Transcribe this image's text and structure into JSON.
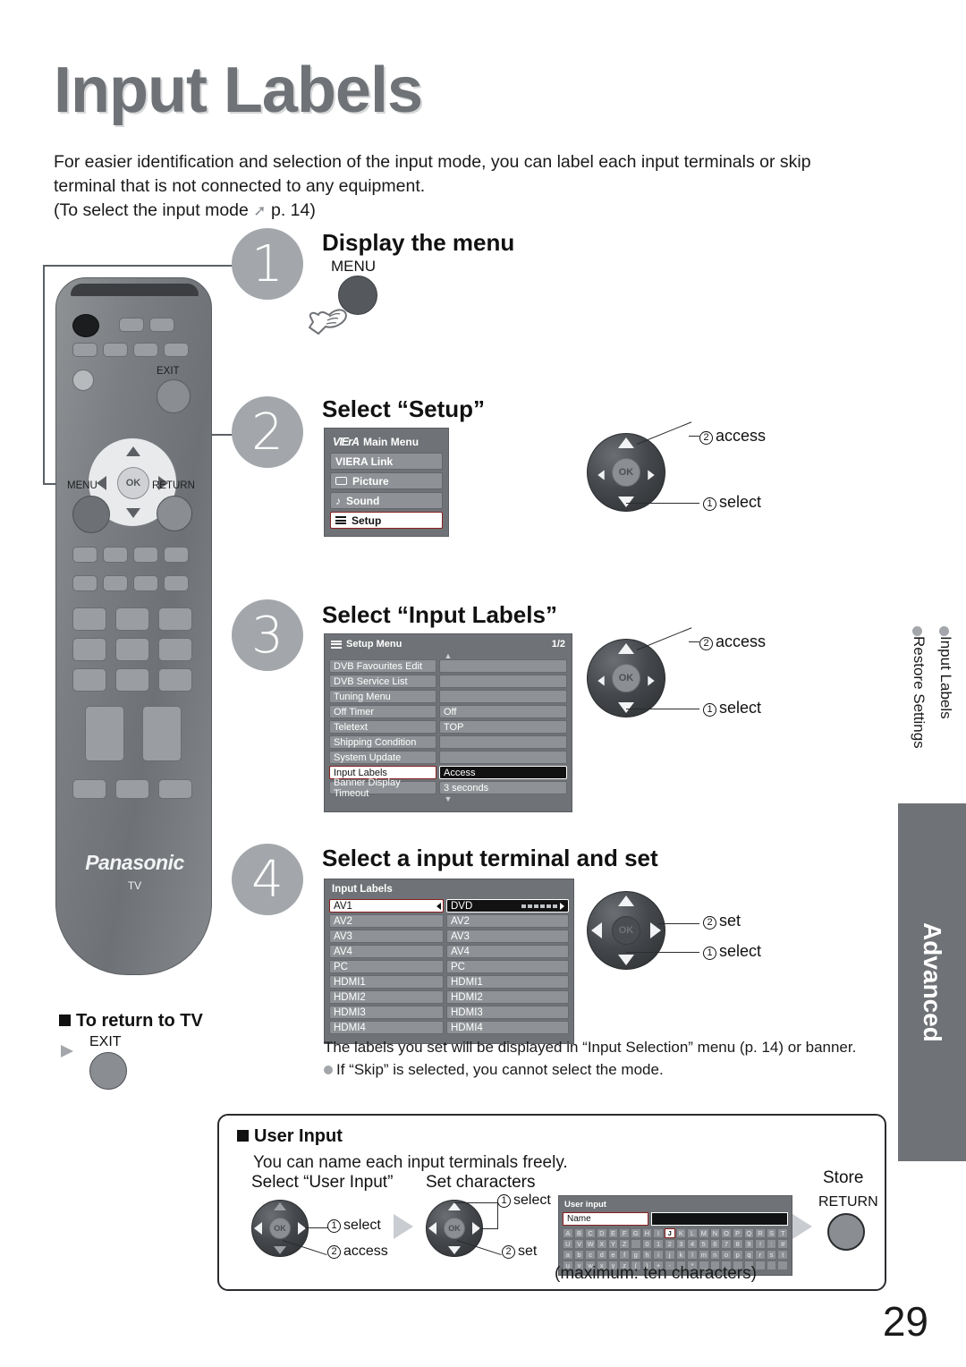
{
  "page": {
    "title": "Input Labels",
    "intro_line1": "For easier identification and selection of the input mode, you can label each input terminals or skip",
    "intro_line2": "terminal that is not connected to any equipment.",
    "intro_line3_pre": "(To select the input mode",
    "intro_line3_post": "p. 14)",
    "page_number": "29"
  },
  "steps": [
    {
      "num": "1",
      "heading": "Display the menu",
      "button_label": "MENU"
    },
    {
      "num": "2",
      "heading": "Select “Setup”"
    },
    {
      "num": "3",
      "heading": "Select “Input Labels”"
    },
    {
      "num": "4",
      "heading": "Select a input terminal and set"
    }
  ],
  "remote": {
    "brand": "Panasonic",
    "brand_sub": "TV",
    "labels": {
      "menu": "MENU",
      "exit": "EXIT",
      "return": "RETURN",
      "ok": "OK"
    }
  },
  "main_menu": {
    "logo": "VIErA",
    "title": "Main Menu",
    "items": [
      {
        "label": "VIERA Link",
        "icon": "none",
        "selected": false
      },
      {
        "label": "Picture",
        "icon": "screen-icon",
        "selected": false
      },
      {
        "label": "Sound",
        "icon": "music-note-icon",
        "selected": false
      },
      {
        "label": "Setup",
        "icon": "list-icon",
        "selected": true
      }
    ]
  },
  "setup_menu": {
    "title": "Setup Menu",
    "page_indicator": "1/2",
    "rows": [
      {
        "key": "DVB Favourites Edit",
        "value": "",
        "selected": false
      },
      {
        "key": "DVB Service List",
        "value": "",
        "selected": false
      },
      {
        "key": "Tuning Menu",
        "value": "",
        "selected": false
      },
      {
        "key": "Off Timer",
        "value": "Off",
        "selected": false
      },
      {
        "key": "Teletext",
        "value": "TOP",
        "selected": false
      },
      {
        "key": "Shipping Condition",
        "value": "",
        "selected": false
      },
      {
        "key": "System Update",
        "value": "",
        "selected": false
      },
      {
        "key": "Input Labels",
        "value": "Access",
        "selected": true
      },
      {
        "key": "Banner Display Timeout",
        "value": "3 seconds",
        "selected": false
      }
    ]
  },
  "input_labels_menu": {
    "title": "Input Labels",
    "rows": [
      {
        "key": "AV1",
        "value": "DVD",
        "selected": true
      },
      {
        "key": "AV2",
        "value": "AV2",
        "selected": false
      },
      {
        "key": "AV3",
        "value": "AV3",
        "selected": false
      },
      {
        "key": "AV4",
        "value": "AV4",
        "selected": false
      },
      {
        "key": "PC",
        "value": "PC",
        "selected": false
      },
      {
        "key": "HDMI1",
        "value": "HDMI1",
        "selected": false
      },
      {
        "key": "HDMI2",
        "value": "HDMI2",
        "selected": false
      },
      {
        "key": "HDMI3",
        "value": "HDMI3",
        "selected": false
      },
      {
        "key": "HDMI4",
        "value": "HDMI4",
        "selected": false
      }
    ]
  },
  "callouts": {
    "step2": {
      "first": "select",
      "second": "access",
      "first_num": "①",
      "second_num": "②"
    },
    "step3": {
      "first": "select",
      "second": "access",
      "first_num": "①",
      "second_num": "②"
    },
    "step4": {
      "first": "select",
      "second": "set",
      "first_num": "①",
      "second_num": "②"
    }
  },
  "note": {
    "line1": "The labels you set will be displayed in “Input Selection” menu (p. 14) or banner.",
    "line2": "If “Skip” is selected, you cannot select the mode."
  },
  "return_to_tv": {
    "heading": "To return to TV",
    "button": "EXIT"
  },
  "user_input": {
    "heading": "User Input",
    "subtitle": "You can name each input terminals freely.",
    "step_a_label": "Select “User Input”",
    "step_a_first": "select",
    "step_a_second": "access",
    "step_b_label": "Set characters",
    "step_b_first": "select",
    "step_b_second": "set",
    "store_label": "Store",
    "store_button": "RETURN",
    "max_chars": "(maximum: ten characters)",
    "osd": {
      "title": "User input",
      "name_label": "Name",
      "highlight_key": "J",
      "rows": [
        [
          "A",
          "B",
          "C",
          "D",
          "E",
          "F",
          "G",
          "H",
          "I",
          "J",
          "K",
          "L",
          "M",
          "N",
          "O",
          "P",
          "Q",
          "R",
          "S",
          "T"
        ],
        [
          "U",
          "V",
          "W",
          "X",
          "Y",
          "Z",
          "",
          "0",
          "1",
          "2",
          "3",
          "4",
          "5",
          "6",
          "7",
          "8",
          "9",
          "!",
          ":",
          "#"
        ],
        [
          "a",
          "b",
          "c",
          "d",
          "e",
          "f",
          "g",
          "h",
          "i",
          "j",
          "k",
          "l",
          "m",
          "n",
          "o",
          "p",
          "q",
          "r",
          "s",
          "t"
        ],
        [
          "u",
          "v",
          "w",
          "x",
          "y",
          "z",
          "(",
          ")",
          "+",
          "-",
          ".",
          "*",
          "_",
          "",
          "",
          "",
          "",
          "",
          "",
          ""
        ]
      ]
    }
  },
  "sidebar": {
    "toc_line1": "Input Labels",
    "toc_line2": "Restore Settings",
    "tab_label": "Advanced"
  },
  "colors": {
    "title_grey": "#6f7276",
    "osd_bg": "#6f7276",
    "osd_row": "#8e9195",
    "selected_red_border": "#8a2020",
    "accent_grey": "#a3a6aa"
  }
}
